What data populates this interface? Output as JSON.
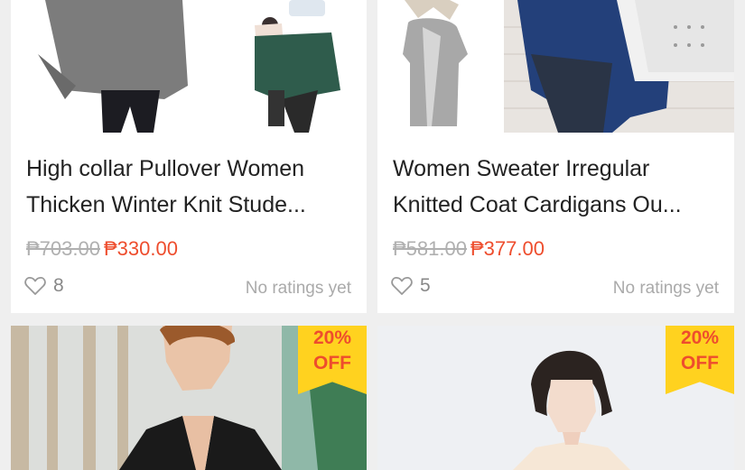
{
  "products": [
    {
      "title_line1": "High collar Pullover Women",
      "title_line2": "Thicken Winter Knit Stude...",
      "old_price": "₱703.00",
      "price": "₱330.00",
      "likes": "8",
      "ratings": "No ratings yet"
    },
    {
      "title_line1": "Women Sweater Irregular",
      "title_line2": "Knitted Coat Cardigans Ou...",
      "old_price": "₱581.00",
      "price": "₱377.00",
      "likes": "5",
      "ratings": "No ratings yet"
    },
    {
      "discount_pct": "20%",
      "discount_label": "OFF"
    },
    {
      "discount_pct": "20%",
      "discount_label": "OFF"
    }
  ],
  "icons": {
    "like": "heart-outline-icon"
  },
  "colors": {
    "price": "#ee4d2d",
    "badge": "#ffd21f"
  }
}
